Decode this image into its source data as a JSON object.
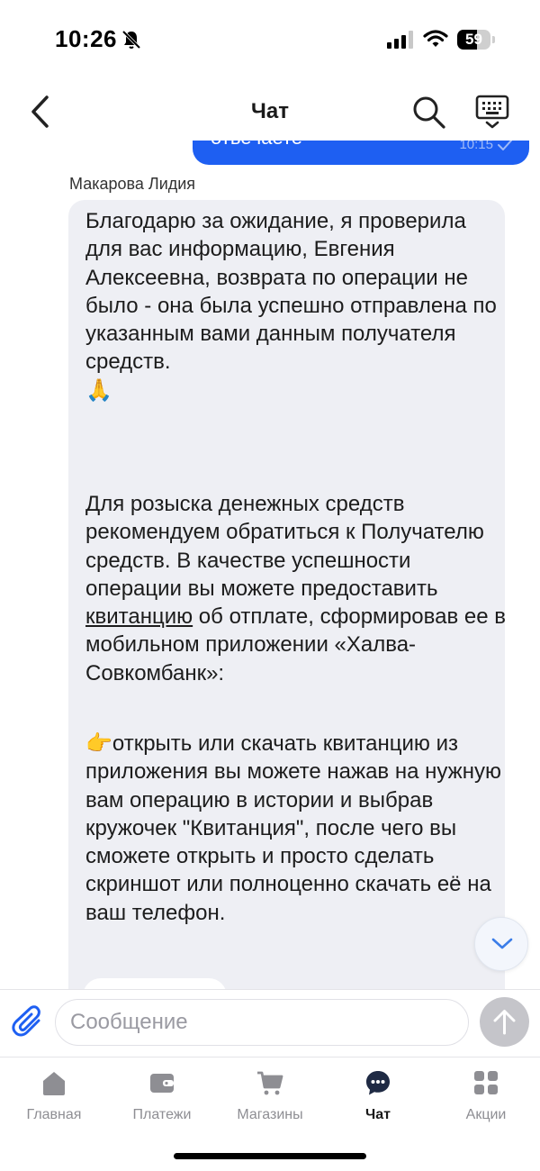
{
  "status_bar": {
    "time": "10:26",
    "battery_level": "59",
    "battery_fraction": 0.59
  },
  "header": {
    "title": "Чат"
  },
  "outgoing_message": {
    "text_fragment": "отвечаете",
    "time": "10:15"
  },
  "incoming_message": {
    "sender": "Макарова Лидия",
    "paragraph1": "Благодарю за ожидание, я проверила для вас информацию, Евгения Алексеевна, возврата по операции не было - она была успешно отправлена по указанным вами данным получателя средств.",
    "emoji1": "🙏",
    "paragraph2_before_link": "Для розыска денежных средств рекомендуем обратиться к Получателю средств. В качестве успешности операции вы можете предоставить ",
    "paragraph2_link": "квитанцию",
    "paragraph2_after_link": " об отплате, сформировав ее в мобильном приложении «Халва-Совкомбанк»:",
    "emoji2": "👉",
    "paragraph3": "открыть или скачать квитанцию из приложения вы можете нажав на нужную вам операцию в истории и выбрав кружочек \"Квитанция\", после чего вы сможете открыть и просто сделать скриншот или полноценно скачать её на ваш телефон."
  },
  "composer": {
    "placeholder": "Сообщение"
  },
  "tabs": [
    {
      "label": "Главная",
      "icon": "home-icon",
      "active": false
    },
    {
      "label": "Платежи",
      "icon": "wallet-icon",
      "active": false
    },
    {
      "label": "Магазины",
      "icon": "cart-icon",
      "active": false
    },
    {
      "label": "Чат",
      "icon": "chat-icon",
      "active": true
    },
    {
      "label": "Акции",
      "icon": "grid-icon",
      "active": false
    }
  ],
  "colors": {
    "accent": "#1e5ff2",
    "incoming_bubble": "#eeeff4",
    "tab_inactive": "#8e8e93",
    "tab_active": "#1a1a1a"
  }
}
